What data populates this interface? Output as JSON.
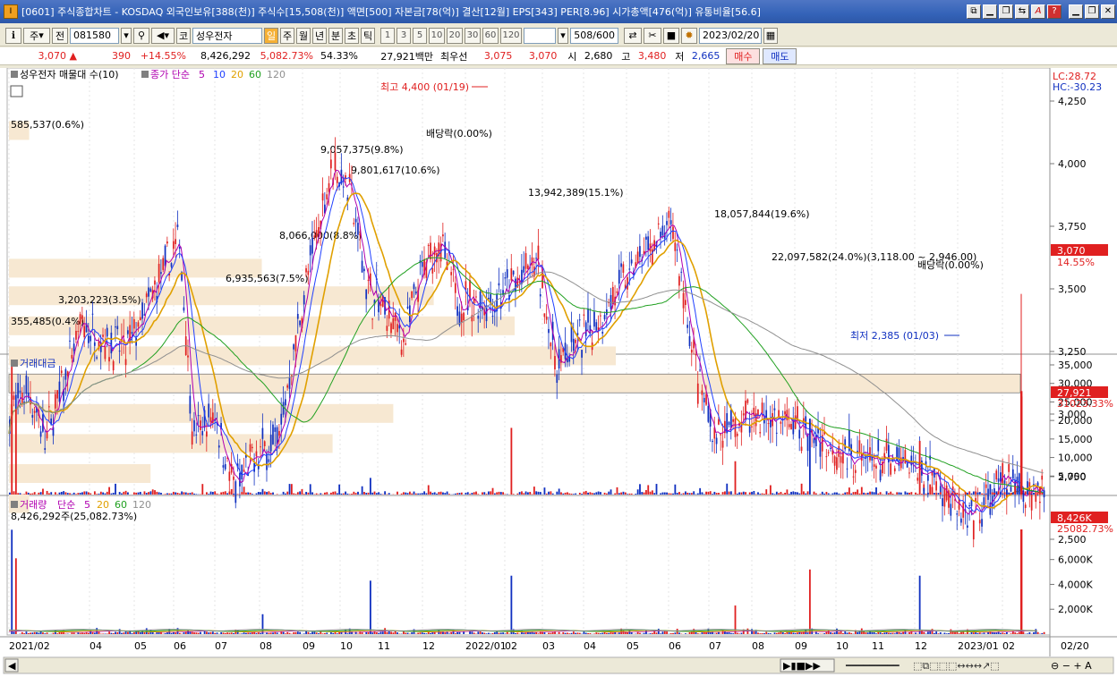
{
  "window": {
    "title": "[0601] 주식종합차트 - KOSDAQ 외국인보유[388(천)] 주식수[15,508(천)] 액면[500] 자본금[78(억)] 결산[12월] EPS[343] PER[8.96] 시가총액[476(억)] 유통비율[56.6]",
    "buttons": [
      "⧉",
      "▁",
      "❐",
      "⇆",
      "A",
      "?",
      "▁",
      "❐",
      "✕"
    ]
  },
  "toolbar": {
    "period_type": "주",
    "prev": "전",
    "code": "081580",
    "market": "코",
    "name": "성우전자",
    "periods": [
      "일",
      "주",
      "월",
      "년",
      "분",
      "초",
      "틱"
    ],
    "active_period": "일",
    "intervals": [
      "1",
      "3",
      "5",
      "10",
      "20",
      "30",
      "60",
      "120"
    ],
    "count": "508",
    "count_max": "/600",
    "date": "2023/02/20"
  },
  "price": {
    "current": "3,070",
    "arrow": "▲",
    "change": "390",
    "change_pct": "+14.55%",
    "volume": "8,426,292",
    "volume_pct": "5,082.73%",
    "ratio": "54.33%",
    "amount": "27,921백만",
    "best_label": "최우선",
    "best_ask": "3,075",
    "best_bid": "3,070",
    "open_label": "시",
    "open": "2,680",
    "high_label": "고",
    "high": "3,480",
    "low_label": "저",
    "low": "2,665",
    "buy": "매수",
    "sell": "매도"
  },
  "price_panel": {
    "legend_title": "성우전자 매물대 수(10)",
    "ma_label": "종가 단순",
    "ma_periods": [
      "5",
      "10",
      "20",
      "60",
      "120"
    ],
    "lc": "LC:28.72",
    "hc": "HC:-30.23",
    "y_ticks": [
      "4,250",
      "4,000",
      "3,750",
      "3,500",
      "3,250",
      "3,000",
      "2,750",
      "2,500"
    ],
    "current_tag": "3,070",
    "current_pct": "14.55%",
    "high_note": "최고 4,400 (01/19)",
    "low_note": "최저 2,385 (01/03)",
    "dividend1": "배당락(0.00%)",
    "dividend2": "배당락(0.00%)",
    "vp_labels": [
      "585,537(0.6%)",
      "9,057,375(9.8%)",
      "9,801,617(10.6%)",
      "13,942,389(15.1%)",
      "18,057,844(19.6%)",
      "22,097,582(24.0%)(3,118.00 ~ 2,946.00)",
      "8,066,000(8.8%)",
      "6,935,563(7.5%)",
      "3,203,223(3.5%)",
      "355,485(0.4%)"
    ]
  },
  "amount_panel": {
    "title": "거래대금",
    "y_ticks": [
      "35,000",
      "30,000",
      "25,000",
      "20,000",
      "15,000",
      "10,000",
      "5,000"
    ],
    "current_tag": "27,921",
    "current_pct": "31023.33%"
  },
  "volume_panel": {
    "title": "거래량",
    "ma_label": "단순",
    "ma_periods": [
      "5",
      "20",
      "60",
      "120"
    ],
    "sub_label": "8,426,292주(25,082.73%)",
    "y_ticks": [
      "6,000K",
      "4,000K",
      "2,000K"
    ],
    "current_tag": "8,426K",
    "current_pct": "25082.73%"
  },
  "x_axis": {
    "labels": [
      "2021/02",
      "04",
      "05",
      "06",
      "07",
      "08",
      "09",
      "10",
      "11",
      "12",
      "2022/01",
      "02",
      "03",
      "04",
      "05",
      "06",
      "07",
      "08",
      "09",
      "10",
      "11",
      "12",
      "2023/01",
      "02"
    ],
    "right_label": "02/20"
  },
  "colors": {
    "up": "#e02020",
    "down": "#1030c0",
    "ma5": "#b000b0",
    "ma10": "#2040ff",
    "ma20": "#e0a000",
    "ma60": "#20a020",
    "ma120": "#909090",
    "vp": "#f7e8d2"
  }
}
